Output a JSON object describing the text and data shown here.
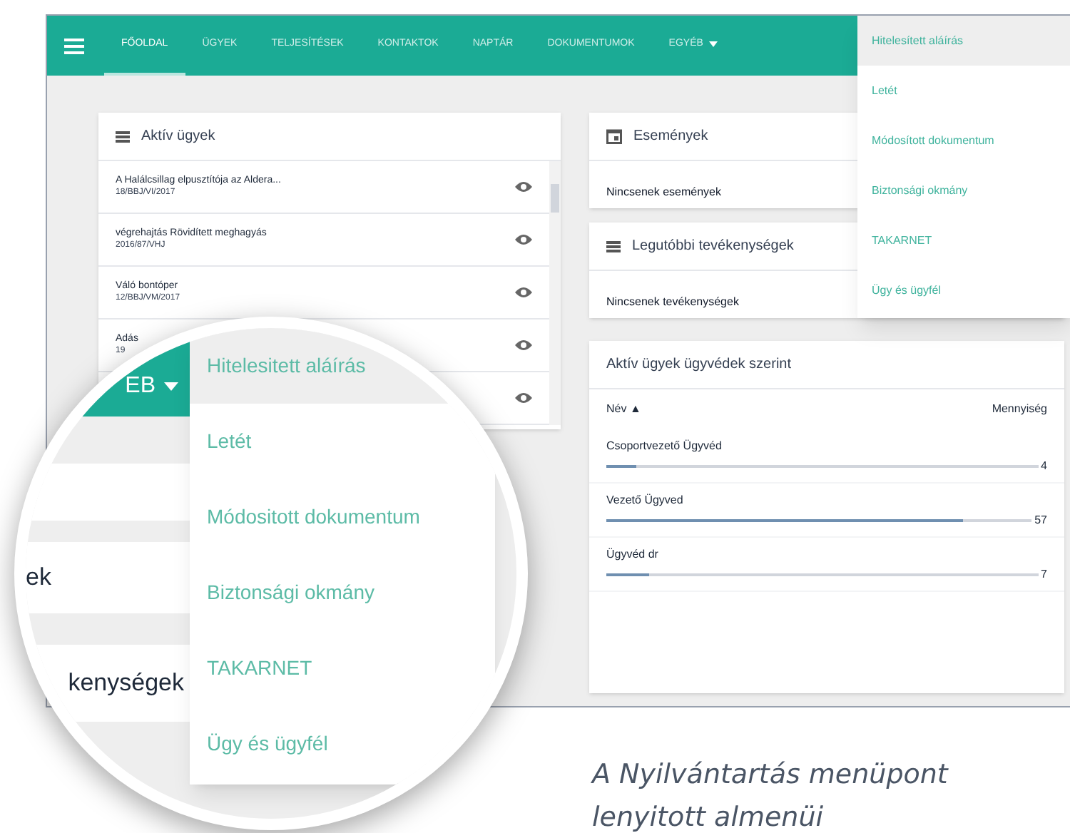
{
  "navbar": {
    "items": [
      {
        "label": "FŐOLDAL",
        "selected": true,
        "caret": false
      },
      {
        "label": "ÜGYEK",
        "selected": false,
        "caret": false
      },
      {
        "label": "TELJESÍTÉSEK",
        "selected": false,
        "caret": false
      },
      {
        "label": "KONTAKTOK",
        "selected": false,
        "caret": false
      },
      {
        "label": "NAPTÁR",
        "selected": false,
        "caret": false
      },
      {
        "label": "DOKUMENTUMOK",
        "selected": false,
        "caret": false
      },
      {
        "label": "EGYÉB",
        "selected": false,
        "caret": true
      }
    ]
  },
  "dropdown": {
    "items": [
      {
        "label": "Hitelesített aláírás",
        "selected": true
      },
      {
        "label": "Letét",
        "selected": false
      },
      {
        "label": "Módosított dokumentum",
        "selected": false
      },
      {
        "label": "Biztonsági okmány",
        "selected": false
      },
      {
        "label": "TAKARNET",
        "selected": false
      },
      {
        "label": "Ügy és ügyfél",
        "selected": false
      }
    ]
  },
  "active_cases": {
    "title": "Aktív ügyek",
    "rows": [
      {
        "title": "A Halálcsillag elpusztítója az Aldera...",
        "number": "18/BBJ/VI/2017"
      },
      {
        "title": "végrehajtás Rövidített meghagyás",
        "number": "2016/87/VHJ"
      },
      {
        "title": "Váló bontóper",
        "number": "12/BBJ/VM/2017"
      },
      {
        "title": "Adás",
        "number": "19"
      },
      {
        "title": "",
        "number": ""
      }
    ]
  },
  "events": {
    "title": "Események",
    "empty_text": "Nincsenek események"
  },
  "recent_activities": {
    "title": "Legutóbbi tevékenységek",
    "empty_text": "Nincsenek tevékenységek"
  },
  "cases_by_lawyer": {
    "title": "Aktív ügyek ügyvédek szerint",
    "columns": [
      "Név ▲",
      "Mennyiség"
    ],
    "rows": [
      {
        "name": "Csoportvezető Ügyvéd",
        "count": "4",
        "level": 0.07
      },
      {
        "name": "Vezető Ügyved",
        "count": "57",
        "level": 0.84
      },
      {
        "name": "Ügyvéd dr",
        "count": "7",
        "level": 0.1
      }
    ]
  },
  "magnifier": {
    "nav_label": "EB",
    "items": [
      {
        "label": "Hitelesitett aláírás",
        "selected": true
      },
      {
        "label": "Letét",
        "selected": false
      },
      {
        "label": "Módositott dokumentum",
        "selected": false
      },
      {
        "label": "Biztonsági okmány",
        "selected": false
      },
      {
        "label": "TAKARNET",
        "selected": false
      },
      {
        "label": "Ügy és ügyfél",
        "selected": false
      }
    ],
    "card_texts": [
      "ek",
      "kenységek"
    ]
  },
  "caption": [
    "A Nyilvántartás menüpont",
    "lenyitott almenüi"
  ]
}
